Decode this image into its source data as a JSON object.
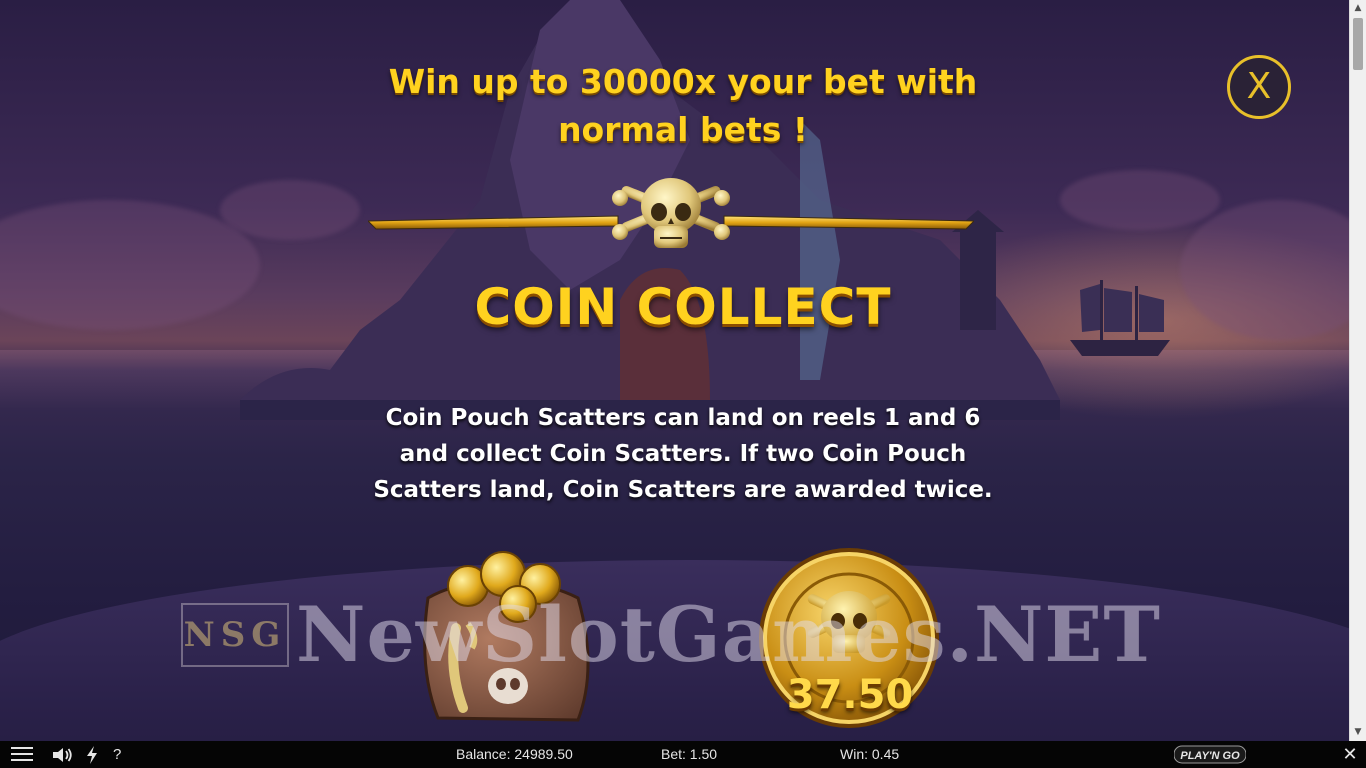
{
  "headline": {
    "line1": "Win up to 30000x your bet with",
    "line2": "normal bets !"
  },
  "feature": {
    "title": "COIN COLLECT",
    "description_lines": [
      "Coin Pouch Scatters can land on reels 1 and 6",
      "and collect Coin Scatters. If two Coin Pouch",
      "Scatters land, Coin Scatters are awarded twice."
    ],
    "coin_value": "37.50"
  },
  "close_button": {
    "label": "X"
  },
  "watermark": {
    "badge": "NSG",
    "text": "NewSlotGames.NET"
  },
  "bottom_bar": {
    "balance": "Balance: 24989.50",
    "bet": "Bet: 1.50",
    "win": "Win: 0.45",
    "help": "?",
    "brand": "PLAY'N GO",
    "close": "✕"
  },
  "icons": {
    "menu": "menu-icon",
    "sound": "speaker-icon",
    "turbo": "lightning-icon",
    "help": "question-icon",
    "divider": "skull-crossbones-icon",
    "pouch": "coin-pouch-icon",
    "coin": "skull-coin-icon"
  },
  "colors": {
    "gold": "#ffd21f",
    "bar": "#050505"
  }
}
